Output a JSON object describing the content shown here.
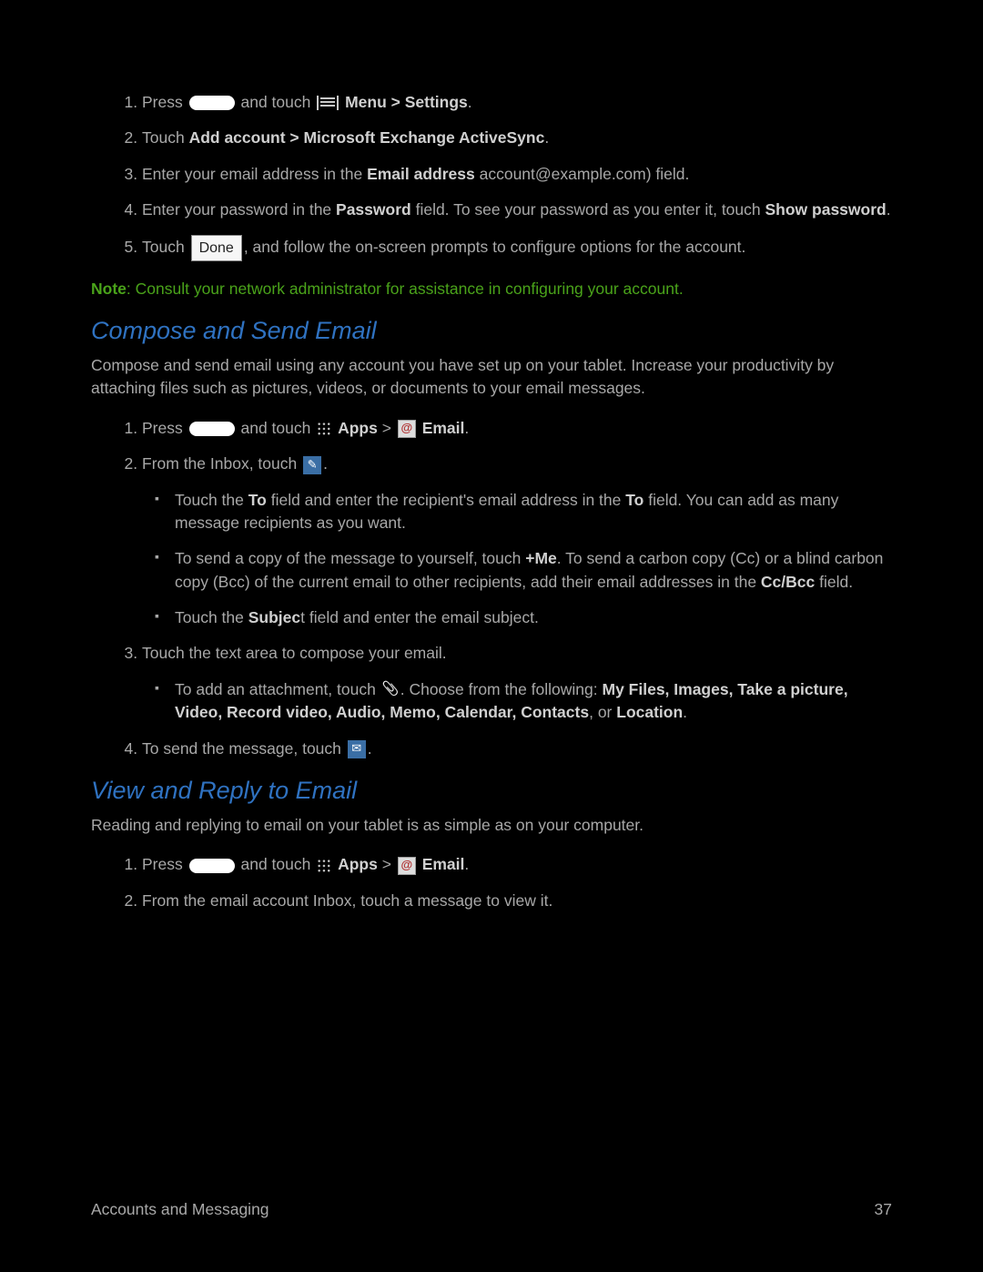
{
  "setup_steps": {
    "s1": {
      "press": "Press",
      "and_touch": "and touch",
      "menu_settings": "Menu > Settings",
      "period": "."
    },
    "s2": {
      "touch": "Touch ",
      "add_account": "Add account > Microsoft Exchange ActiveSync",
      "period": "."
    },
    "s3": {
      "pre": "Enter your email address in the ",
      "field": "Email address",
      "post": " account@example.com) field."
    },
    "s4": {
      "pre": "Enter your password in the ",
      "pw": "Password",
      "mid": " field. To see your password as you enter it, touch ",
      "show": "Show password",
      "period": "."
    },
    "s5": {
      "touch": "Touch ",
      "done_label": "Done",
      "rest": ", and follow the on-screen prompts to configure options for the account."
    }
  },
  "note": {
    "label": "Note",
    "text": ": Consult your network administrator for assistance in configuring your account."
  },
  "compose": {
    "heading": "Compose and Send Email",
    "intro": "Compose and send email using any account you have set up on your tablet. Increase your productivity by attaching files such as pictures, videos, or documents to your email messages.",
    "s1": {
      "press": "Press",
      "and_touch": "and touch",
      "apps": "Apps",
      "gt": " > ",
      "email": "Email",
      "period": "."
    },
    "s2": {
      "text": "From the Inbox, touch ",
      "period": "."
    },
    "s2_bullets": {
      "b1": {
        "pre": "Touch the ",
        "to1": "To",
        "mid": " field and enter the recipient's email address in the ",
        "to2": "To",
        "post": " field. You can add as many message recipients as you want."
      },
      "b2": {
        "pre": "To send a copy of the message to yourself, touch ",
        "me": "+Me",
        "mid": ". To send a carbon copy (Cc) or a blind carbon copy (Bcc) of the current email to other recipients, add their email addresses in the ",
        "ccbcc": "Cc/Bcc",
        "post": " field."
      },
      "b3": {
        "pre": "Touch the ",
        "subj": "Subjec",
        "t": "t field and enter the email subject."
      }
    },
    "s3": {
      "text": "Touch the text area to compose your email."
    },
    "s3_bullets": {
      "b1": {
        "pre": "To add an attachment, touch ",
        "choose": ". Choose from the following: ",
        "opts": "My Files, Images, Take a picture, Video, Record video, Audio, Memo, Calendar, Contacts",
        "or": ", or ",
        "loc": "Location",
        "period": "."
      }
    },
    "s4": {
      "text": "To send the message, touch ",
      "period": "."
    }
  },
  "view": {
    "heading": "View and Reply to Email",
    "intro": "Reading and replying to email on your tablet is as simple as on your computer.",
    "s1": {
      "press": "Press",
      "and_touch": "and touch",
      "apps": "Apps",
      "gt": " > ",
      "email": "Email",
      "period": "."
    },
    "s2": {
      "text": "From the email account Inbox, touch a message to view it."
    }
  },
  "footer": {
    "section": "Accounts and Messaging",
    "page": "37"
  }
}
